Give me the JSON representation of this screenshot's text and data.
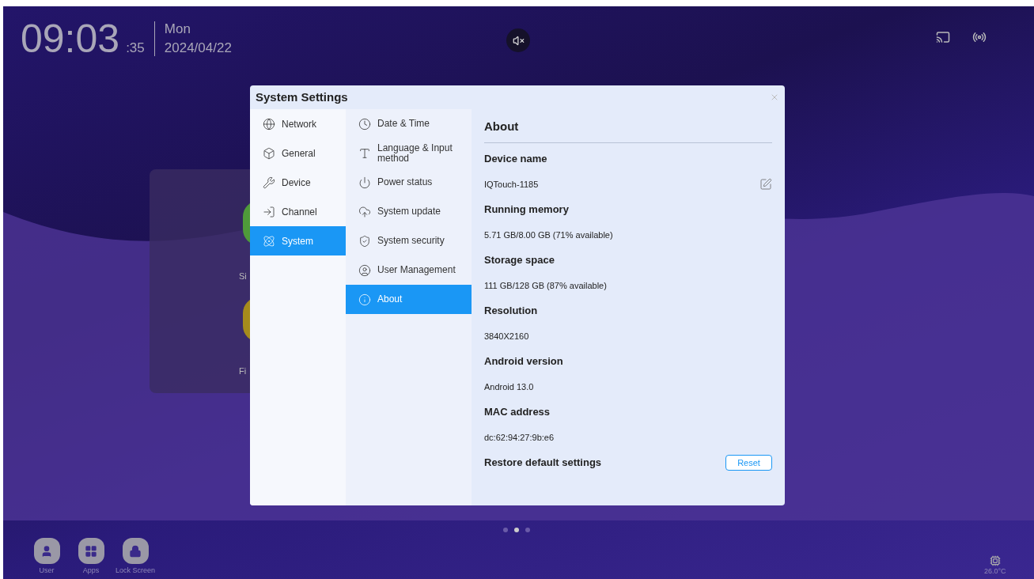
{
  "clock": {
    "time": "09:03",
    "seconds": ":35",
    "weekday": "Mon",
    "date": "2024/04/22"
  },
  "widget": {
    "labels": [
      "Si",
      "Fi"
    ]
  },
  "dialog": {
    "title": "System Settings",
    "categories": [
      {
        "label": "Network",
        "selected": false
      },
      {
        "label": "General",
        "selected": false
      },
      {
        "label": "Device",
        "selected": false
      },
      {
        "label": "Channel",
        "selected": false
      },
      {
        "label": "System",
        "selected": true
      }
    ],
    "subitems": [
      {
        "label": "Date & Time",
        "selected": false
      },
      {
        "label": "Language & Input method",
        "selected": false
      },
      {
        "label": "Power status",
        "selected": false
      },
      {
        "label": "System update",
        "selected": false
      },
      {
        "label": "System security",
        "selected": false
      },
      {
        "label": "User Management",
        "selected": false
      },
      {
        "label": "About",
        "selected": true
      }
    ],
    "about": {
      "heading": "About",
      "fields": [
        {
          "label": "Device name",
          "value": "IQTouch-1185",
          "editable": true
        },
        {
          "label": "Running memory",
          "value": "5.71 GB/8.00 GB (71% available)",
          "editable": false
        },
        {
          "label": "Storage space",
          "value": "111 GB/128 GB (87% available)",
          "editable": false
        },
        {
          "label": "Resolution",
          "value": "3840X2160",
          "editable": false
        },
        {
          "label": "Android version",
          "value": "Android 13.0",
          "editable": false
        },
        {
          "label": "MAC address",
          "value": "dc:62:94:27:9b:e6",
          "editable": false
        }
      ],
      "restore": {
        "label": "Restore default settings",
        "button": "Reset"
      }
    }
  },
  "pager": [
    {
      "selected": false
    },
    {
      "selected": true
    },
    {
      "selected": false
    }
  ],
  "dock": [
    "User",
    "Apps",
    "Lock Screen"
  ],
  "temperature": "26.0°C"
}
